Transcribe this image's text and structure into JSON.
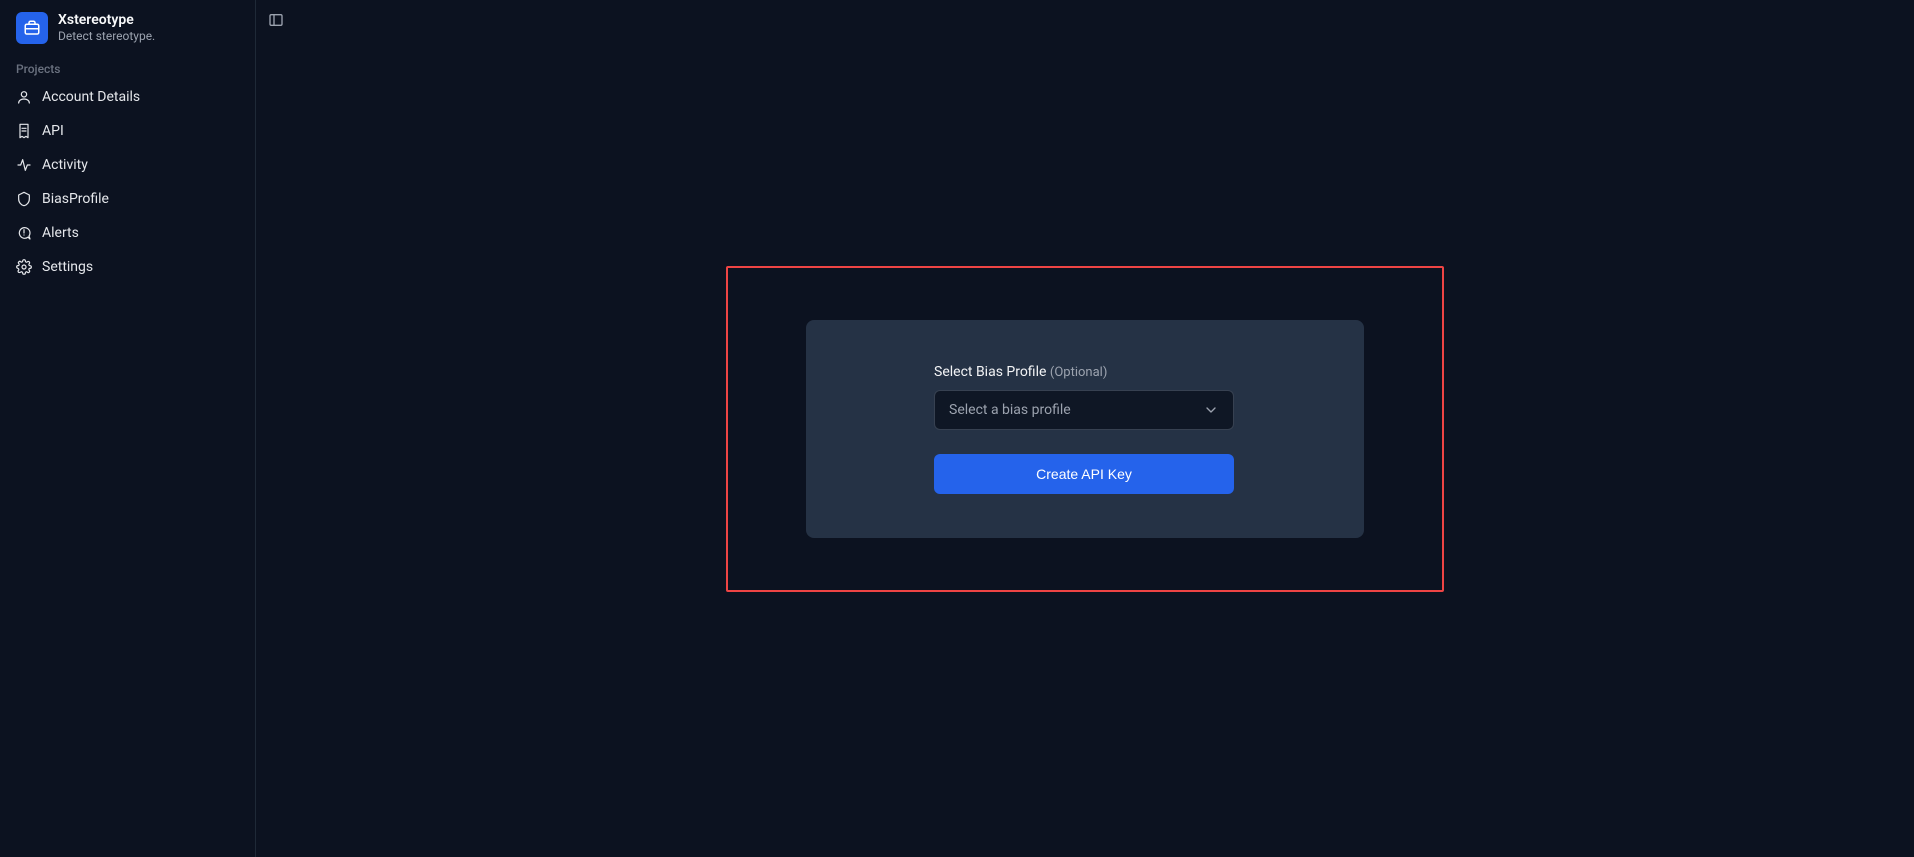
{
  "brand": {
    "title": "Xstereotype",
    "subtitle": "Detect stereotype."
  },
  "sidebar": {
    "section_label": "Projects",
    "items": [
      {
        "label": "Account Details"
      },
      {
        "label": "API"
      },
      {
        "label": "Activity"
      },
      {
        "label": "BiasProfile"
      },
      {
        "label": "Alerts"
      },
      {
        "label": "Settings"
      }
    ]
  },
  "form": {
    "label_main": "Select Bias Profile",
    "label_optional": "(Optional)",
    "select_placeholder": "Select a bias profile",
    "submit_label": "Create API Key"
  },
  "colors": {
    "accent": "#2563eb",
    "highlight_border": "#ef4444",
    "card_bg": "#253245",
    "page_bg": "#0c1220"
  }
}
